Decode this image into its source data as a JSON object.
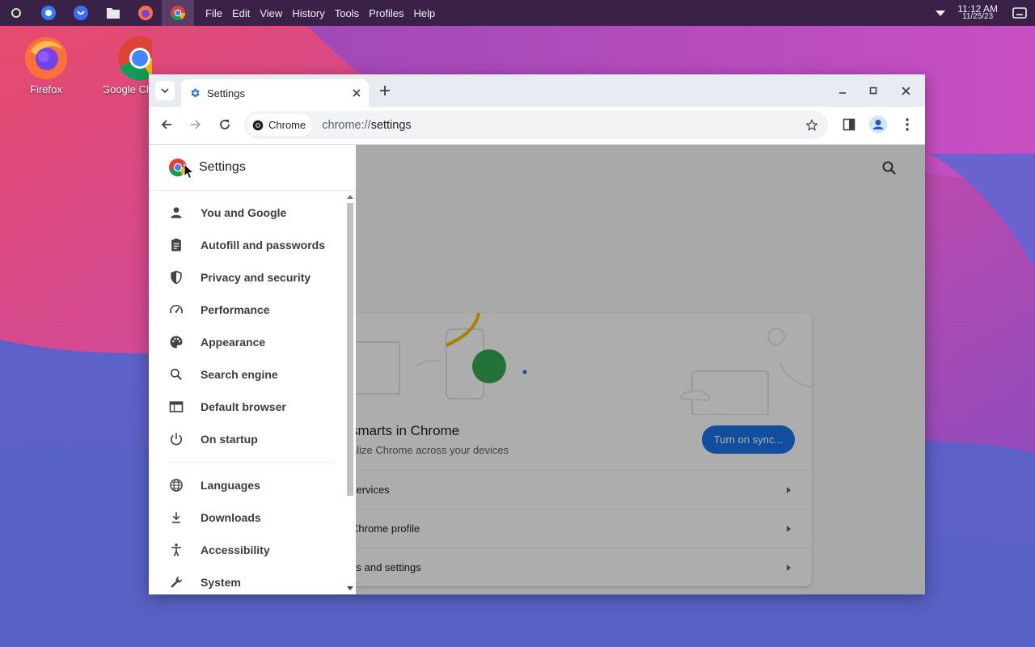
{
  "panel": {
    "menu": [
      "File",
      "Edit",
      "View",
      "History",
      "Tools",
      "Profiles",
      "Help"
    ],
    "clock": {
      "time": "11:12 AM",
      "date": "11/25/23"
    }
  },
  "desktop": {
    "icons": [
      {
        "label": "Firefox"
      },
      {
        "label": "Google Ch"
      }
    ]
  },
  "browser": {
    "tab": {
      "title": "Settings"
    },
    "chip_label": "Chrome",
    "url_scheme": "chrome://",
    "url_path": "settings"
  },
  "drawer": {
    "title": "Settings",
    "items_group1": [
      {
        "label": "You and Google",
        "icon": "person-icon"
      },
      {
        "label": "Autofill and passwords",
        "icon": "clipboard-icon"
      },
      {
        "label": "Privacy and security",
        "icon": "shield-icon"
      },
      {
        "label": "Performance",
        "icon": "speedometer-icon"
      },
      {
        "label": "Appearance",
        "icon": "palette-icon"
      },
      {
        "label": "Search engine",
        "icon": "search-icon"
      },
      {
        "label": "Default browser",
        "icon": "browser-window-icon"
      },
      {
        "label": "On startup",
        "icon": "power-icon"
      }
    ],
    "items_group2": [
      {
        "label": "Languages",
        "icon": "globe-icon"
      },
      {
        "label": "Downloads",
        "icon": "download-icon"
      },
      {
        "label": "Accessibility",
        "icon": "accessibility-icon"
      },
      {
        "label": "System",
        "icon": "wrench-icon"
      }
    ]
  },
  "page": {
    "card_title": "smarts in Chrome",
    "card_sub": "alize Chrome across your devices",
    "sync_button": "Turn on sync...",
    "rows": [
      "services",
      "Chrome profile",
      "ks and settings"
    ]
  },
  "colors": {
    "accent": "#1a73e8",
    "panel": "#3a2147"
  }
}
